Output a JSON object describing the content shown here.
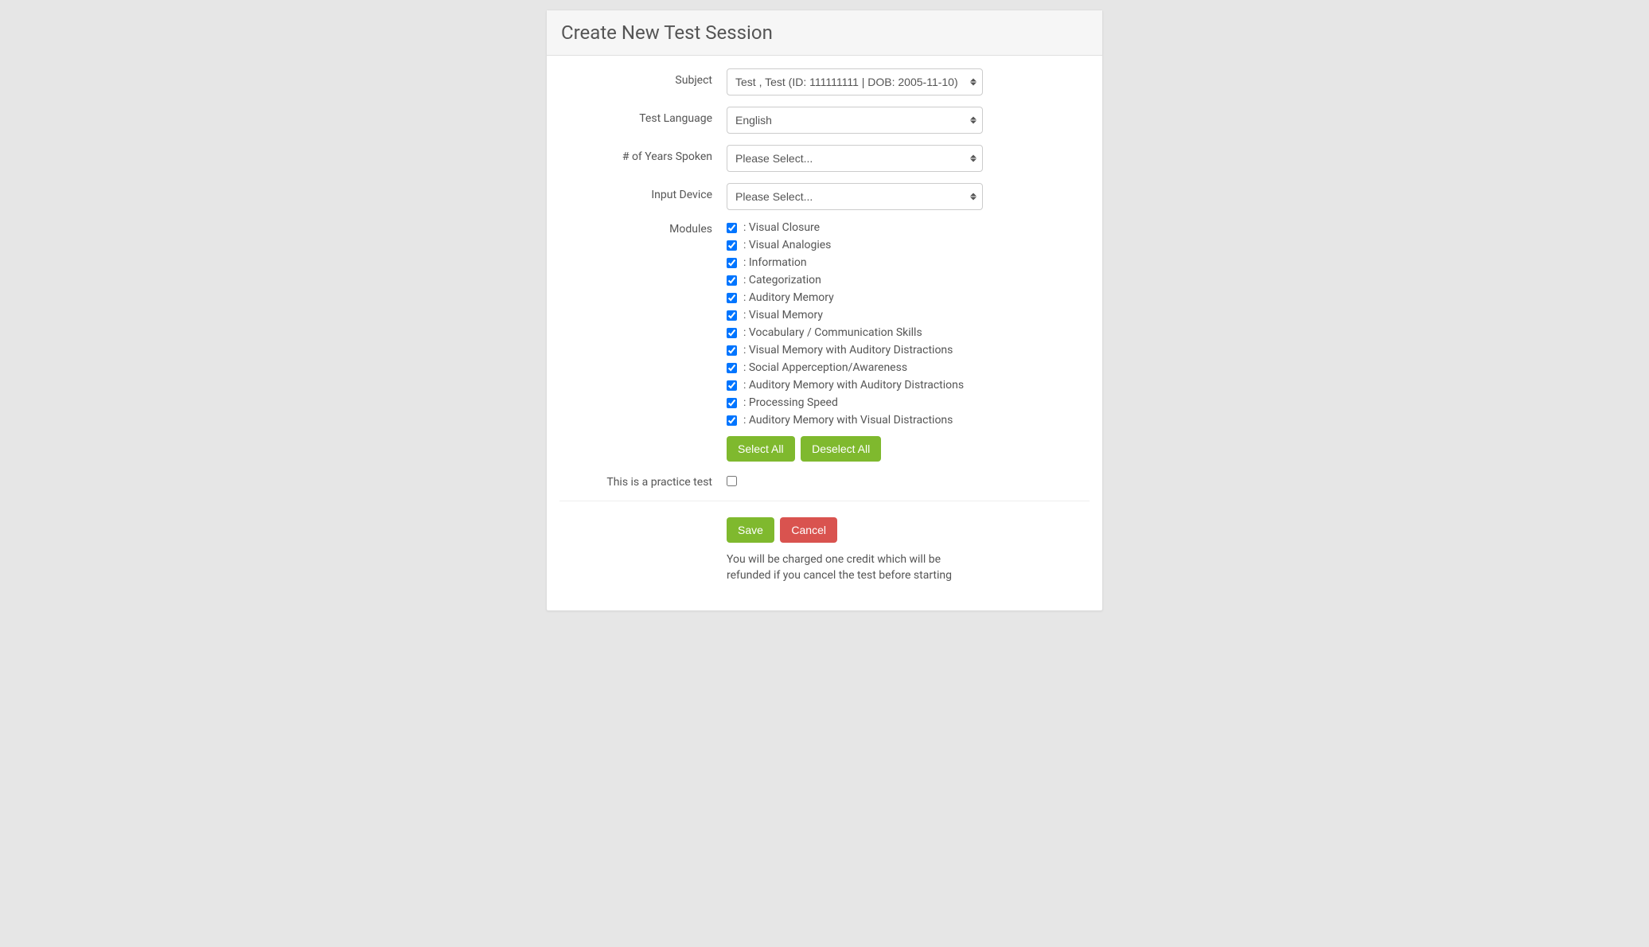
{
  "header": {
    "title": "Create New Test Session"
  },
  "fields": {
    "subject": {
      "label": "Subject",
      "value": "Test , Test (ID: 111111111 | DOB: 2005-11-10)"
    },
    "test_language": {
      "label": "Test Language",
      "value": "English"
    },
    "years_spoken": {
      "label": "# of Years Spoken",
      "value": "Please Select..."
    },
    "input_device": {
      "label": "Input Device",
      "value": "Please Select..."
    },
    "modules": {
      "label": "Modules",
      "items": [
        {
          "checked": true,
          "label": ": Visual Closure"
        },
        {
          "checked": true,
          "label": ": Visual Analogies"
        },
        {
          "checked": true,
          "label": ": Information"
        },
        {
          "checked": true,
          "label": ": Categorization"
        },
        {
          "checked": true,
          "label": ": Auditory Memory"
        },
        {
          "checked": true,
          "label": ": Visual Memory"
        },
        {
          "checked": true,
          "label": ": Vocabulary / Communication Skills"
        },
        {
          "checked": true,
          "label": ": Visual Memory with Auditory Distractions"
        },
        {
          "checked": true,
          "label": ": Social Apperception/Awareness"
        },
        {
          "checked": true,
          "label": ": Auditory Memory with Auditory Distractions"
        },
        {
          "checked": true,
          "label": ": Processing Speed"
        },
        {
          "checked": true,
          "label": ": Auditory Memory with Visual Distractions"
        }
      ],
      "select_all_label": "Select All",
      "deselect_all_label": "Deselect All"
    },
    "practice": {
      "label": "This is a practice test",
      "checked": false
    }
  },
  "actions": {
    "save_label": "Save",
    "cancel_label": "Cancel"
  },
  "footer": {
    "charge_notice": "You will be charged one credit which will be refunded if you cancel the test before starting"
  }
}
